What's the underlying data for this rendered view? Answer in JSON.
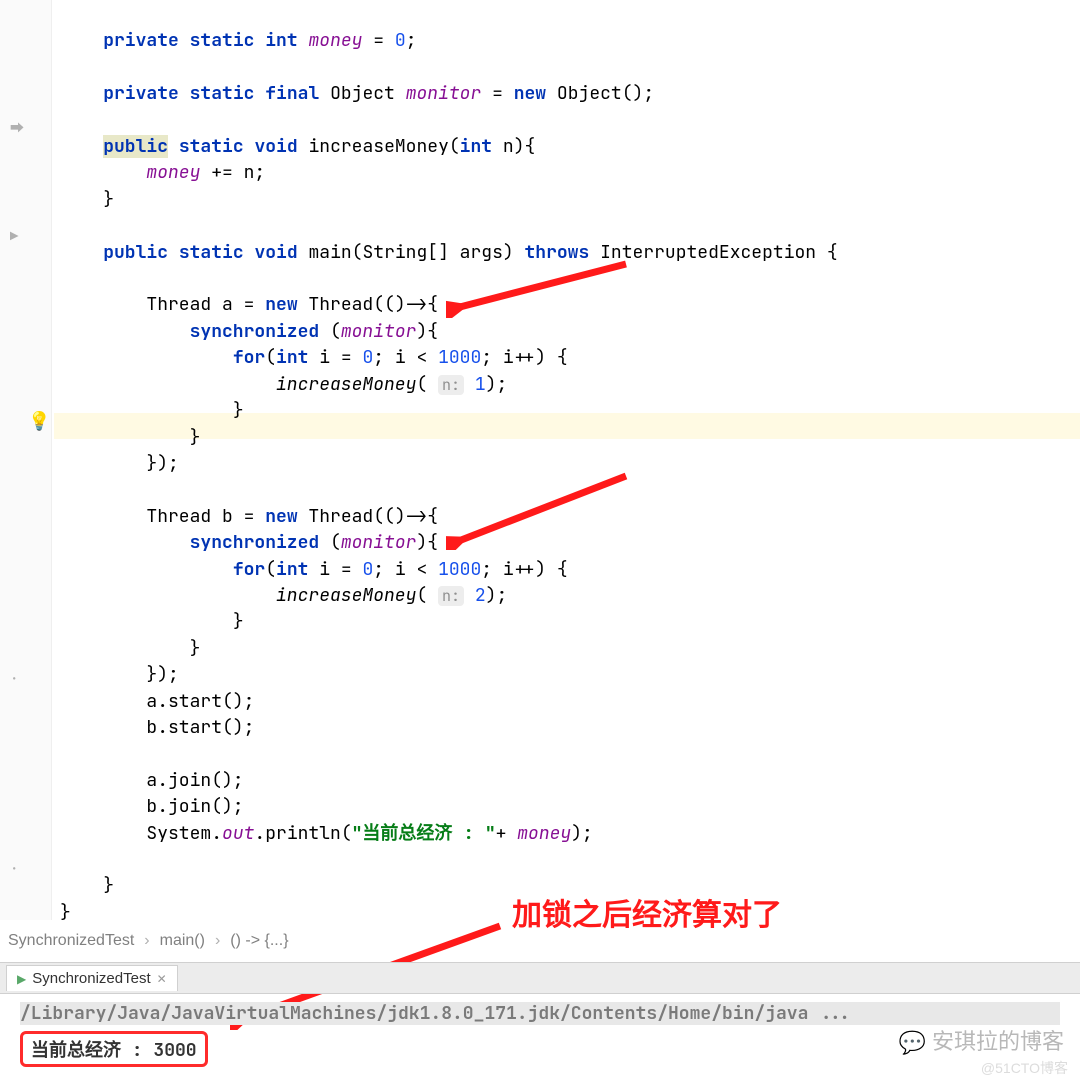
{
  "code": {
    "l1": {
      "kw1": "private",
      "kw2": "static",
      "kw3": "int",
      "field": "money",
      "eq": " = ",
      "num": "0",
      "semi": ";"
    },
    "l2": {
      "kw1": "private",
      "kw2": "static",
      "kw3": "final",
      "type": "Object",
      "field": "monitor",
      "eq": " = ",
      "kw4": "new",
      "type2": "Object();"
    },
    "l3": {
      "kw1": "public",
      "kw2": "static",
      "kw3": "void",
      "name": "increaseMoney(",
      "kw4": "int",
      "arg": "n){"
    },
    "l4": {
      "field": "money",
      "rest": " += n;"
    },
    "l5": {
      "brace": "}"
    },
    "l6": {
      "kw1": "public",
      "kw2": "static",
      "kw3": "void",
      "name": "main(String[] args)",
      "kw4": "throws",
      "exc": "InterruptedException {"
    },
    "l7": {
      "txt": "Thread a = ",
      "kw": "new",
      "txt2": " Thread(()->{"
    },
    "l8": {
      "kw": "synchronized",
      "txt": " (",
      "field": "monitor",
      "txt2": "){"
    },
    "l9": {
      "kw": "for",
      "txt": "(",
      "kw2": "int",
      "txt2": " i = ",
      "num": "0",
      "txt3": "; i < ",
      "num2": "1000",
      "txt4": "; i++) {"
    },
    "l10": {
      "fn": "increaseMoney",
      "hint": "n:",
      "num": "1",
      "txt": ");"
    },
    "l11": {
      "brace": "}"
    },
    "l12": {
      "brace": "}"
    },
    "l13": {
      "brace": "});"
    },
    "l14": {
      "txt": "Thread b = ",
      "kw": "new",
      "txt2": " Thread(()->{"
    },
    "l15": {
      "kw": "synchronized",
      "txt": " (",
      "field": "monitor",
      "txt2": "){"
    },
    "l16": {
      "kw": "for",
      "txt": "(",
      "kw2": "int",
      "txt2": " i = ",
      "num": "0",
      "txt3": "; i < ",
      "num2": "1000",
      "txt4": "; i++) {"
    },
    "l17": {
      "fn": "increaseMoney",
      "hint": "n:",
      "num": "2",
      "txt": ");"
    },
    "l18": {
      "brace": "}"
    },
    "l19": {
      "brace": "}"
    },
    "l20": {
      "brace": "});"
    },
    "l21": {
      "txt": "a.start();"
    },
    "l22": {
      "txt": "b.start();"
    },
    "l23": {
      "txt": "a.join();"
    },
    "l24": {
      "txt": "b.join();"
    },
    "l25": {
      "txt": "System.",
      "field": "out",
      "txt2": ".println(",
      "str": "\"当前总经济 : \"",
      "txt3": "+ ",
      "field2": "money",
      "txt4": ");"
    },
    "l26": {
      "brace": "}"
    },
    "l27": {
      "brace": "}"
    }
  },
  "breadcrumbs": {
    "c1": "SynchronizedTest",
    "c2": "main()",
    "c3": "() -> {...}"
  },
  "tool_tab": {
    "label": "SynchronizedTest"
  },
  "console": {
    "path": "/Library/Java/JavaVirtualMachines/jdk1.8.0_171.jdk/Contents/Home/bin/java ...",
    "output": "当前总经济 : 3000"
  },
  "annotation": "加锁之后经济算对了",
  "watermark": "安琪拉的博客",
  "watermark2": "@51CTO博客"
}
